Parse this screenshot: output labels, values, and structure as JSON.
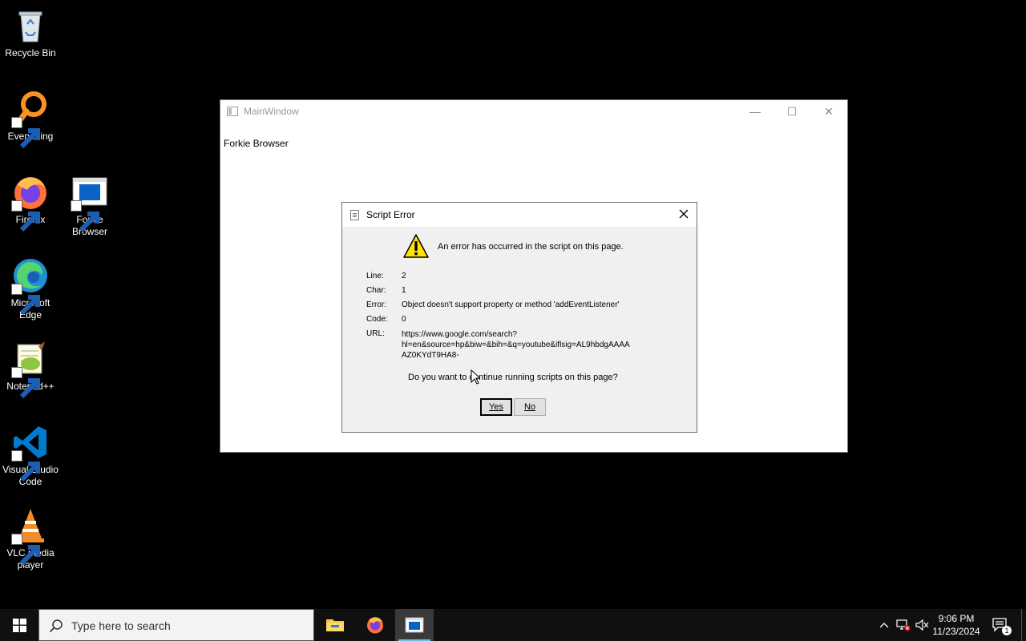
{
  "desktop": {
    "icons": [
      {
        "label": "Recycle Bin"
      },
      {
        "label": "Everything"
      },
      {
        "label": "Firefox"
      },
      {
        "label": "Forkie Browser"
      },
      {
        "label": "Microsoft Edge"
      },
      {
        "label": "Notepad++"
      },
      {
        "label": "Visual Studio Code"
      },
      {
        "label": "VLC media player"
      }
    ]
  },
  "main_window": {
    "title": "MainWindow",
    "content_label": "Forkie Browser",
    "minimize_glyph": "—",
    "maximize_glyph": "☐",
    "close_glyph": "✕"
  },
  "dialog": {
    "title": "Script Error",
    "header_message": "An error has occurred in the script on this page.",
    "fields": [
      {
        "label": "Line:",
        "value": "2"
      },
      {
        "label": "Char:",
        "value": "1"
      },
      {
        "label": "Error:",
        "value": "Object doesn't support property or method 'addEventListener'"
      },
      {
        "label": "Code:",
        "value": "0"
      },
      {
        "label": "URL:",
        "value_lines": [
          "https://www.google.com/search?",
          "hl=en&source=hp&biw=&bih=&q=youtube&iflsig=AL9hbdgAAAA",
          "AZ0KYdT9HA8-"
        ]
      }
    ],
    "question": "Do you want to continue running scripts on this page?",
    "yes_label": "Yes",
    "no_label": "No"
  },
  "taskbar": {
    "search_placeholder": "Type here to search",
    "time": "9:06 PM",
    "date": "11/23/2024",
    "notification_count": "1",
    "accent_color": "#76b9ed"
  }
}
